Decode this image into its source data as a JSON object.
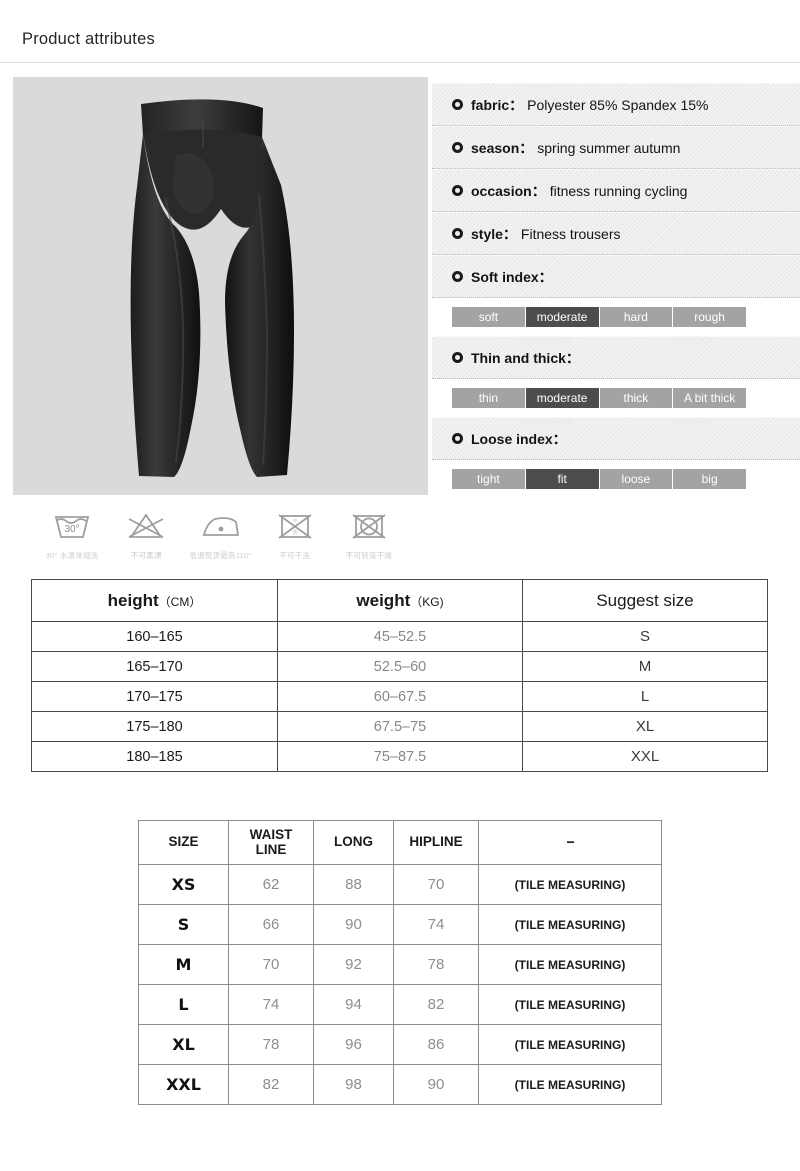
{
  "header": {
    "title": "Product attributes"
  },
  "product": {
    "image_alt": "black-compression-tights",
    "background_color": "#dadada"
  },
  "care_instructions": [
    {
      "icon": "wash-30-degrees-icon",
      "caption": "30° 水温常规洗"
    },
    {
      "icon": "no-bleach-icon",
      "caption": "不可氯漂"
    },
    {
      "icon": "iron-low-heat-icon",
      "caption": "低温熨烫最高110°"
    },
    {
      "icon": "no-dry-clean-icon",
      "caption": "不可干洗"
    },
    {
      "icon": "no-tumble-dry-icon",
      "caption": "不可转笼干燥"
    }
  ],
  "attributes": [
    {
      "label": "fabric：",
      "value": "Polyester 85% Spandex 15%"
    },
    {
      "label": "season：",
      "value": "spring summer autumn"
    },
    {
      "label": "occasion：",
      "value": "fitness running cycling"
    },
    {
      "label": "style：",
      "value": "Fitness trousers"
    }
  ],
  "indices": [
    {
      "label": "Soft index：",
      "segments": [
        "soft",
        "moderate",
        "hard",
        "rough"
      ],
      "active": 1
    },
    {
      "label": "Thin and thick：",
      "segments": [
        "thin",
        "moderate",
        "thick",
        "A bit thick"
      ],
      "active": 1
    },
    {
      "label": "Loose index：",
      "segments": [
        "tight",
        "fit",
        "loose",
        "big"
      ],
      "active": 1
    }
  ],
  "colors": {
    "segment_inactive": "#a3a3a3",
    "segment_active": "#4d4d4d",
    "panel_background": "#ebebeb",
    "photo_background": "#dadada"
  },
  "size_suggestion_table": {
    "headers": {
      "height": "height",
      "height_unit": "（CM）",
      "weight": "weight",
      "weight_unit": "（KG)",
      "suggest": "Suggest size"
    },
    "rows": [
      {
        "height": "160–165",
        "weight": "45–52.5",
        "size": "S"
      },
      {
        "height": "165–170",
        "weight": "52.5–60",
        "size": "M"
      },
      {
        "height": "170–175",
        "weight": "60–67.5",
        "size": "L"
      },
      {
        "height": "175–180",
        "weight": "67.5–75",
        "size": "XL"
      },
      {
        "height": "180–185",
        "weight": "75–87.5",
        "size": "XXL"
      }
    ]
  },
  "measurement_table": {
    "headers": [
      "SIZE",
      "WAIST LINE",
      "LONG",
      "HIPLINE",
      "--"
    ],
    "header_waist_line1": "WAIST",
    "header_waist_line2": "LINE",
    "rows": [
      {
        "size": "XS",
        "waist": "62",
        "long": "88",
        "hipline": "70",
        "note": "(TILE MEASURING)"
      },
      {
        "size": "S",
        "waist": "66",
        "long": "90",
        "hipline": "74",
        "note": "(TILE MEASURING)"
      },
      {
        "size": "M",
        "waist": "70",
        "long": "92",
        "hipline": "78",
        "note": "(TILE MEASURING)"
      },
      {
        "size": "L",
        "waist": "74",
        "long": "94",
        "hipline": "82",
        "note": "(TILE MEASURING)"
      },
      {
        "size": "XL",
        "waist": "78",
        "long": "96",
        "hipline": "86",
        "note": "(TILE MEASURING)"
      },
      {
        "size": "XXL",
        "waist": "82",
        "long": "98",
        "hipline": "90",
        "note": "(TILE MEASURING)"
      }
    ]
  }
}
